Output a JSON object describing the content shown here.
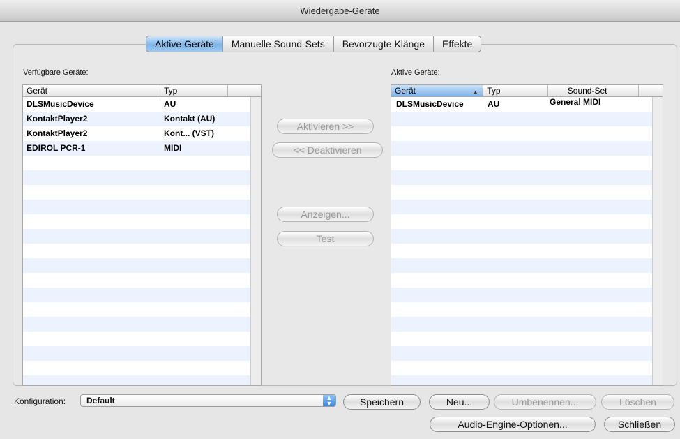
{
  "window": {
    "title": "Wiedergabe-Geräte"
  },
  "tabs": [
    {
      "label": "Aktive Geräte",
      "active": true
    },
    {
      "label": "Manuelle Sound-Sets"
    },
    {
      "label": "Bevorzugte Klänge"
    },
    {
      "label": "Effekte"
    }
  ],
  "available": {
    "label": "Verfügbare Geräte:",
    "columns": [
      "Gerät",
      "Typ"
    ],
    "rows": [
      {
        "device": "DLSMusicDevice",
        "type": "AU"
      },
      {
        "device": "KontaktPlayer2",
        "type": "Kontakt (AU)"
      },
      {
        "device": "KontaktPlayer2",
        "type": "Kont... (VST)"
      },
      {
        "device": "EDIROL PCR-1",
        "type": "MIDI"
      }
    ]
  },
  "active": {
    "label": "Aktive Geräte:",
    "columns": [
      "Gerät",
      "Typ",
      "Sound-Set"
    ],
    "sorted_column": "Gerät",
    "rows": [
      {
        "device": "DLSMusicDevice",
        "type": "AU",
        "soundset": "General MIDI"
      }
    ]
  },
  "middle_buttons": {
    "activate": "Aktivieren >>",
    "deactivate": "<< Deaktivieren",
    "show": "Anzeigen...",
    "test": "Test"
  },
  "config": {
    "label": "Konfiguration:",
    "value": "Default"
  },
  "bottom_buttons": {
    "save": "Speichern",
    "new": "Neu...",
    "rename": "Umbenennen...",
    "delete": "Löschen",
    "audio_engine": "Audio-Engine-Optionen...",
    "close": "Schließen"
  },
  "colors": {
    "accent": "#7fb6ea",
    "row_alt": "#edf3fe"
  }
}
